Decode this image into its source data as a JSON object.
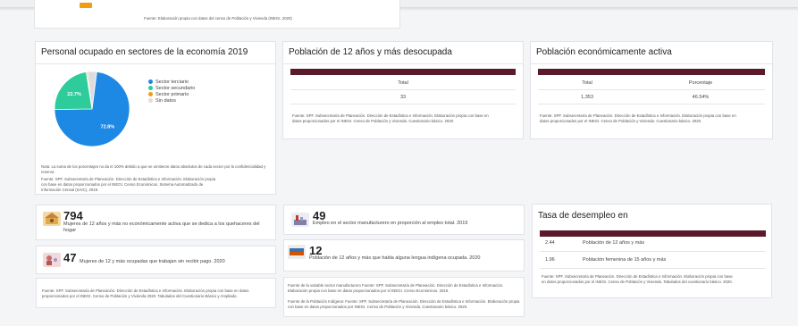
{
  "top_source": "Fuente: Elaboración propia con datos del censo de Población y Vivienda (INEGI, 2020)",
  "pie_panel": {
    "title": "Personal ocupado en sectores de la economía 2019",
    "legend": [
      "Sector terciario",
      "Sector secundario",
      "Sector primario",
      "Sin datos"
    ],
    "note": "Nota: La suma de los porcentajes no da el 100% debido a que se omitieron datos absolutos de cada sector por la confidencialidad y reserva",
    "source": "Fuente: SPF. Subsecretaría de Planeación. Dirección de Estadística e Información. Elaboración propia con base en datos proporcionados por el INEGI. Censo Económicos. Sistema Automatizado de Información Censal (SAIC), 2019."
  },
  "chart_data": {
    "type": "pie",
    "labels": [
      "Sector terciario",
      "Sector secundario",
      "Sector primario",
      "Sin datos"
    ],
    "values": [
      72.8,
      22.7,
      0.5,
      4.0
    ],
    "data_labels": [
      "72.8%",
      "22.7%",
      "",
      ""
    ],
    "colors": [
      "#1e88e5",
      "#2ecc9a",
      "#f39c12",
      "#dddddd"
    ]
  },
  "desocupada": {
    "title": "Población de 12 años y más desocupada",
    "header": "Total",
    "value": "33",
    "source": "Fuente: SPF. Subsecretaría de Planeación. Dirección de Estadística e Información. Elaboración propia con base en datos proporcionados por el INEGI. Censo de Población y Vivienda. Cuestionario básico. 2020."
  },
  "activa": {
    "title": "Población económicamente activa",
    "headers": [
      "Total",
      "Porcentaje"
    ],
    "values": [
      "1,353",
      "46.54%"
    ],
    "source": "Fuente: SPF. Subsecretaría de Planeación. Dirección de Estadística e Información. Elaboración propia con base en datos proporcionados por el INEGI. Censo de Población y Vivienda. Cuestionario básico. 2020."
  },
  "stats_left": {
    "card1": {
      "number": "794",
      "text": "Mujeres de 12 años y más no económicamente activa que se dedica a los quehaceres del hogar"
    },
    "card2": {
      "number": "47",
      "text": "Mujeres de 12 y más ocupadas que trabajan sin recibir pago. 2020"
    },
    "source": "Fuente: SPF. Subsecretaría de Planeación. Dirección de Estadística e Información. Elaboración propia con base en datos proporcionados por el INEGI. Censo de Población y Vivienda 2020. Tabulados del Cuestionario Básico y Ampliado."
  },
  "stats_mid": {
    "card1": {
      "number": "49",
      "text": "Empleo en el sector manufacturero en proporción al empleo total. 2019"
    },
    "card2": {
      "number": "12",
      "text": "Población de 12 años y más que habla alguna lengua indígena ocupada. 2020"
    },
    "source1": "Fuente de la variable sector manufacturero Fuente: SPF. Subsecretaría de Planeación. Dirección de Estadística e Información. Elaboración propia con base en datos proporcionados por el INEGI. Censo Económicos. 2019.",
    "source2": "Fuente de la Población Indígena: Fuente: SPF. Subsecretaría de Planeación. Dirección de Estadística e Información. Elaboración propia con base en datos proporcionados por INEGI. Censo de Población y Vivienda. Cuestionario básico. 2020."
  },
  "desempleo": {
    "title": "Tasa de desempleo en",
    "rows": [
      {
        "value": "2.44",
        "label": "Población de 12 años y más"
      },
      {
        "value": "1.96",
        "label": "Población femenina de 15 años y más"
      }
    ],
    "source": "Fuente: SPF. Subsecretaría de Planeación. Dirección de Estadística e Información. Elaboración propia con base en datos proporcionados por el INEGI. Censo de Población y Vivienda. Tabulados del cuestionario básico. 2020."
  }
}
